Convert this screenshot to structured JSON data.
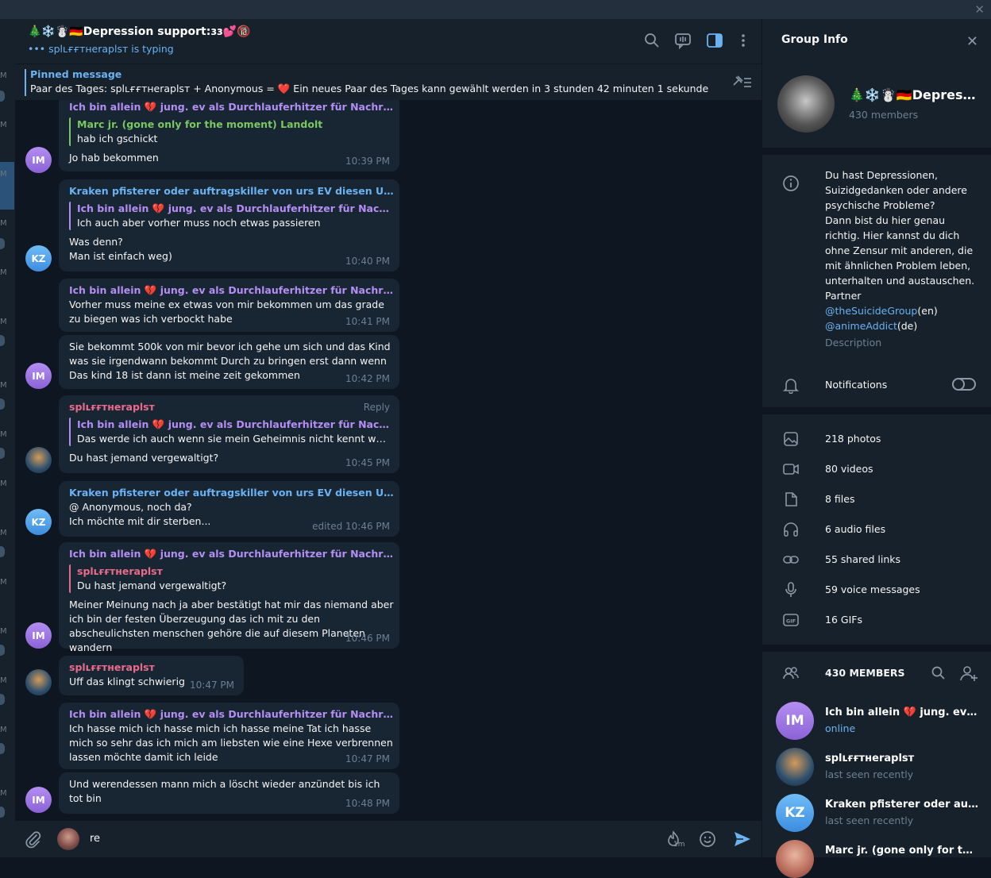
{
  "colors": {
    "accent": "#6ab2f2",
    "purple_name": "#b48ef2",
    "blue_name": "#6ab2f2",
    "pink_name": "#e96b8c",
    "green_name": "#7bc862",
    "bg": "#0e1621",
    "panel": "#17212b",
    "bubble": "#182533"
  },
  "header": {
    "title": "🎄❄️☃️🇩🇪Depression support:ɜɜ💕🔞",
    "status": "••• splʟғғᴛнeraplsт is typing",
    "icons": [
      "search-icon",
      "voice-chat-icon",
      "sidebar-toggle-icon",
      "more-icon"
    ]
  },
  "pinned": {
    "title": "Pinned message",
    "text": "Paar des Tages: splʟғғᴛнeraplsт + Anonymous = ❤️  Ein neues Paar des Tages kann gewählt werden in 3 stunden 42 minuten 1 sekunde"
  },
  "messages": [
    {
      "name": "Ich bin allein 💔 jung. ev als Durchlauferhitzer für Nachrichte...",
      "quote_name": "Marc jr. (gone only for the moment) Landolt",
      "quote_text": "hab ich gschickt",
      "text": "Jo hab bekommen",
      "time": "10:39 PM",
      "avatar": "IM"
    },
    {
      "name": "Kraken pfisterer oder auftragskiller von urs EV diesen USER RA...",
      "quote_name": "Ich bin allein 💔 jung. ev als Durchlauferhitzer für Nachricht...",
      "quote_text": "Ich auch aber vorher muss noch etwas passieren",
      "text": "Was denn?\nMan ist einfach weg)",
      "time": "10:40 PM",
      "avatar": "KZ"
    },
    {
      "name": "Ich bin allein 💔 jung. ev als Durchlauferhitzer für Nachrichte...",
      "text": "Vorher muss meine ex etwas von mir bekommen um das grade zu biegen was ich verbockt habe",
      "time": "10:41 PM"
    },
    {
      "text": "Sie bekommt 500k von mir bevor ich gehe um sich und das Kind was sie irgendwann bekommt Durch zu bringen erst dann wenn Das kind 18 ist dann ist meine zeit gekommen",
      "time": "10:42 PM",
      "avatar": "IM"
    },
    {
      "name": "splʟғғᴛнeraplsт",
      "reply": "Reply",
      "quote_name": "Ich bin allein 💔 jung. ev als Durchlauferhitzer für Nachricht...",
      "quote_text": "Das werde ich auch wenn sie mein Geheimnis nicht kennt werd...",
      "text": "Du hast jemand vergewaltigt?",
      "time": "10:45 PM"
    },
    {
      "name": "Kraken pfisterer oder auftragskiller von urs EV diesen USER RA...",
      "text": "@ Anonymous, noch da?\nIch möchte mit dir sterben...",
      "time": "edited 10:46 PM",
      "avatar": "KZ"
    },
    {
      "name": "Ich bin allein 💔 jung. ev als Durchlauferhitzer für Nachrichte...",
      "quote_name": "splʟғғᴛнeraplsт",
      "quote_text": "Du hast jemand vergewaltigt?",
      "text": "Meiner Meinung nach ja aber bestätigt hat mir das niemand aber ich bin der festen Überzeugung das ich mit zu den abscheulichsten menschen gehöre die auf diesem Planeten wandern",
      "time": "10:46 PM",
      "avatar": "IM"
    },
    {
      "name": "splʟғғᴛнeraplsт",
      "text": "Uff das klingt schwierig",
      "time": "10:47 PM"
    },
    {
      "name": "Ich bin allein 💔 jung. ev als Durchlauferhitzer für Nachrichte...",
      "text": "Ich hasse mich ich hasse mich ich hasse meine Tat ich hasse mich so sehr das ich mich am liebsten wie eine Hexe verbrennen lassen möchte damit ich leide",
      "time": "10:47 PM"
    },
    {
      "text": "Und werendessen mann mich a löscht wieder anzündet bis ich tot bin",
      "time": "10:48 PM",
      "avatar": "IM"
    }
  ],
  "composer": {
    "value": "re",
    "timer_label": "1m",
    "icons": [
      "attach-icon",
      "timer-icon",
      "emoji-icon",
      "send-icon"
    ]
  },
  "group_info": {
    "title": "Group Info",
    "name": "🎄❄️☃️🇩🇪Depressi...",
    "members_count": "430 members",
    "description_lines": [
      "Du hast Depressionen,",
      "Suizidgedanken oder andere",
      "psychische Probleme?",
      "Dann bist du hier genau",
      "richtig. Hier kannst du dich",
      "ohne Zensur mit anderen, die",
      "mit ähnlichen Problem leben,",
      "unterhalten und austauschen.",
      "Partner"
    ],
    "link1": "@theSuicideGroup",
    "link1_suffix": "(en)",
    "link2": "@animeAddict",
    "link2_suffix": "(de)",
    "description_label": "Description",
    "notifications": "Notifications",
    "notifications_on": false,
    "media": [
      {
        "label": "218 photos",
        "icon": "photo-icon"
      },
      {
        "label": "80 videos",
        "icon": "video-icon"
      },
      {
        "label": "8 files",
        "icon": "file-icon"
      },
      {
        "label": "6 audio files",
        "icon": "headphones-icon"
      },
      {
        "label": "55 shared links",
        "icon": "link-icon"
      },
      {
        "label": "59 voice messages",
        "icon": "microphone-icon"
      },
      {
        "label": "16 GIFs",
        "icon": "gif-icon"
      }
    ],
    "members_header": "430 MEMBERS",
    "members": [
      {
        "name": "Ich bin allein 💔 jung. ev als ...",
        "status": "online",
        "initials": "IM"
      },
      {
        "name": "splʟғғᴛнeraplsт",
        "status": "last seen recently",
        "initials": ""
      },
      {
        "name": "Kraken pfisterer oder auftrag...",
        "status": "last seen recently",
        "initials": "KZ"
      },
      {
        "name": "Marc jr. (gone only for the m...",
        "status": "",
        "initials": ""
      }
    ]
  }
}
